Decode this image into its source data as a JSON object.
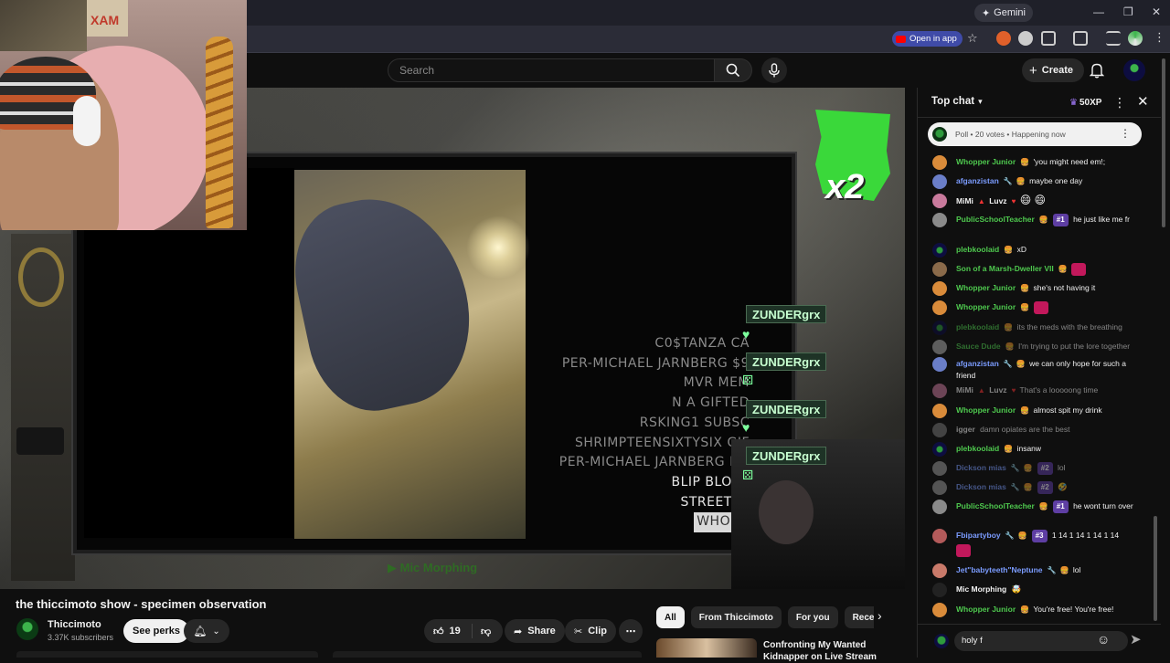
{
  "browser": {
    "gemini_label": "Gemini",
    "open_in_app_label": "Open in app"
  },
  "header": {
    "search_placeholder": "Search",
    "create_label": "Create"
  },
  "video": {
    "credits": [
      {
        "text": "C0$TANZA CA",
        "style": "dim"
      },
      {
        "text": "PER-MICHAEL JARNBERG $9",
        "style": "dim"
      },
      {
        "text": "MVR MEM",
        "style": "dim"
      },
      {
        "text": "N A GIFTED",
        "style": "dim"
      },
      {
        "text": "RSKING1 SUBSC",
        "style": "dim"
      },
      {
        "text": "SHRIMPTEENSIXTYSIX GIF",
        "style": "dim"
      },
      {
        "text": "PER-MICHAEL JARNBERG ME",
        "style": "dim"
      },
      {
        "text": "BLIP BLORP",
        "style": "bright"
      },
      {
        "text": "STREETYZ",
        "style": "bright"
      },
      {
        "text": "WHOPP",
        "style": "boxed"
      }
    ],
    "alerts": [
      "ZUNDERgrx",
      "ZUNDERgrx",
      "ZUNDERgrx",
      "ZUNDERgrx"
    ],
    "multiplier": "x2",
    "ticker": "Mic Morphing"
  },
  "info": {
    "title": "the thiccimoto show - specimen observation",
    "channel_name": "Thiccimoto",
    "subscribers": "3.37K subscribers",
    "perks_label": "See perks",
    "like_count": "19",
    "share_label": "Share",
    "clip_label": "Clip"
  },
  "recommendations": {
    "chips": [
      "All",
      "From Thiccimoto",
      "For you",
      "Recently uploaded"
    ],
    "first_title_line1": "Confronting My Wanted",
    "first_title_line2": "Kidnapper on Live Stream"
  },
  "chat": {
    "mode_label": "Top chat",
    "xp_label": "50XP",
    "poll_text": "Poll • 20 votes • Happening now",
    "input_value": "holy f",
    "messages": [
      {
        "name": "Whopper Junior",
        "text": "'you might need em!;"
      },
      {
        "name": "afganzistan",
        "text": "maybe one day"
      },
      {
        "name": "MiMi",
        "name2": "Luvz",
        "text": "😄 😄"
      },
      {
        "name": "PublicSchoolTeacher",
        "rank": "#1",
        "text": "he just like me fr"
      },
      {
        "name": "plebkoolaid",
        "text": "xD"
      },
      {
        "name": "Son of a Marsh-Dweller VII",
        "text": ""
      },
      {
        "name": "Whopper Junior",
        "text": "she's not having it"
      },
      {
        "name": "Whopper Junior",
        "text": ""
      },
      {
        "name": "plebkoolaid",
        "text": "its the meds with the breathing"
      },
      {
        "name": "Sauce Dude",
        "text": "I'm trying to put the lore together"
      },
      {
        "name": "afganzistan",
        "text": "we can only hope for such a friend"
      },
      {
        "name": "MiMi",
        "name2": "Luvz",
        "text": "That's a looooong time"
      },
      {
        "name": "Whopper Junior",
        "text": "almost spit my drink"
      },
      {
        "name": "igger",
        "text": "damn opiates are the best"
      },
      {
        "name": "plebkoolaid",
        "text": "insanw"
      },
      {
        "name": "Dickson mias",
        "rank": "#2",
        "text": "lol"
      },
      {
        "name": "Dickson mias",
        "rank": "#2",
        "text": "🤣"
      },
      {
        "name": "PublicSchoolTeacher",
        "rank": "#1",
        "text": "he wont turn over"
      },
      {
        "name": "Fbipartyboy",
        "rank": "#3",
        "text": "1 14 1 14 1 14 1 14"
      },
      {
        "name": "Jet\"babyteeth\"Neptune",
        "text": "lol"
      },
      {
        "name": "Mic Morphing",
        "text": "🤯"
      },
      {
        "name": "Whopper Junior",
        "text": "You're free! You're free!"
      }
    ]
  }
}
